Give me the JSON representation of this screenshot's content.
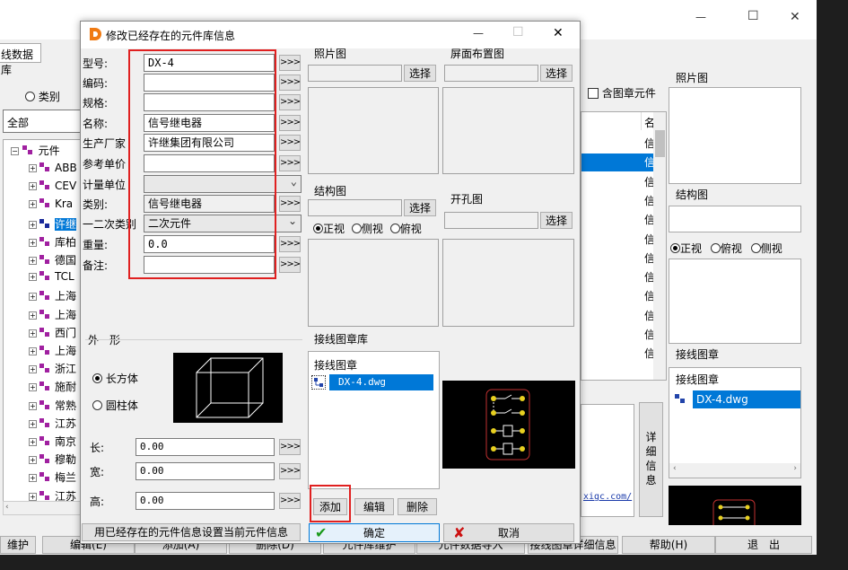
{
  "background_window": {
    "title_fragment": "线数据库",
    "radio_category_label": "类别",
    "dropdown_all": "全部",
    "tree_root": "元件",
    "tree_items": [
      "ABB",
      "CEV",
      "Kra",
      "许继",
      "库柏",
      "德国",
      "TCL",
      "上海",
      "上海",
      "西门",
      "上海",
      "浙江",
      "施耐",
      "常熟",
      "江苏",
      "南京",
      "穆勒",
      "梅兰",
      "江苏"
    ],
    "checkbox_include_symbol": "含图章元件",
    "list_header": "名",
    "list_cells": [
      "信",
      "信",
      "信",
      "信",
      "信",
      "信",
      "信",
      "信",
      "信",
      "信",
      "信",
      "信"
    ],
    "photo_label": "照片图",
    "structure_label": "结构图",
    "view_front": "正视",
    "view_top": "俯视",
    "view_side": "侧视",
    "wiring_label": "接线图章",
    "wiring_list_header": "接线图章",
    "wiring_item": "DX-4.dwg",
    "detail_button": "详细信息",
    "url_fragment": "xigc.com/",
    "bottom_buttons": [
      "维护",
      "编辑(E)",
      "添加(A)",
      "删除(D)",
      "元件库维护",
      "元件数据导入",
      "接线图章详细信息",
      "帮助(H)",
      "退　出"
    ],
    "win_controls": {
      "minimize": "—",
      "maximize": "☐",
      "close": "✕"
    }
  },
  "dialog": {
    "title": "修改已经存在的元件库信息",
    "controls": {
      "minimize": "—",
      "maximize": "☐",
      "close": "✕"
    },
    "fields": [
      {
        "label": "型号:",
        "value": "DX-4",
        "type": "text"
      },
      {
        "label": "编码:",
        "value": "",
        "type": "text"
      },
      {
        "label": "规格:",
        "value": "",
        "type": "text"
      },
      {
        "label": "名称:",
        "value": "信号继电器",
        "type": "text"
      },
      {
        "label": "生产厂家",
        "value": "许继集团有限公司",
        "type": "text"
      },
      {
        "label": "参考单价",
        "value": "",
        "type": "text"
      },
      {
        "label": "计量单位",
        "value": "",
        "type": "combo"
      },
      {
        "label": "类别:",
        "value": "信号继电器",
        "type": "readonly"
      },
      {
        "label": "一二次类别",
        "value": "二次元件",
        "type": "combo"
      },
      {
        "label": "重量:",
        "value": "0.0",
        "type": "text"
      },
      {
        "label": "备注:",
        "value": "",
        "type": "text"
      }
    ],
    "more_button": ">>>",
    "shape_label": "外　形",
    "shape_box": "长方体",
    "shape_cylinder": "圆柱体",
    "dims": [
      {
        "label": "长:",
        "value": "0.00"
      },
      {
        "label": "宽:",
        "value": "0.00"
      },
      {
        "label": "高:",
        "value": "0.00"
      }
    ],
    "use_existing_button": "用已经存在的元件信息设置当前元件信息",
    "photo_label": "照片图",
    "screen_layout_label": "屏面布置图",
    "structure_label": "结构图",
    "cutout_label": "开孔图",
    "select_button": "选择",
    "view_front": "正视",
    "view_side": "侧视",
    "view_top": "俯视",
    "wiring_lib_label": "接线图章库",
    "wiring_list_header": "接线图章",
    "wiring_item": "DX-4.dwg",
    "add_button": "添加",
    "edit_button": "编辑",
    "delete_button": "删除",
    "ok_button": "确定",
    "cancel_button": "取消"
  },
  "colors": {
    "selection": "#0078d7",
    "highlight_box": "#e02020",
    "ok_check": "#1a9a1a",
    "cancel_x": "#cc1111",
    "logo": "#f07a12"
  }
}
